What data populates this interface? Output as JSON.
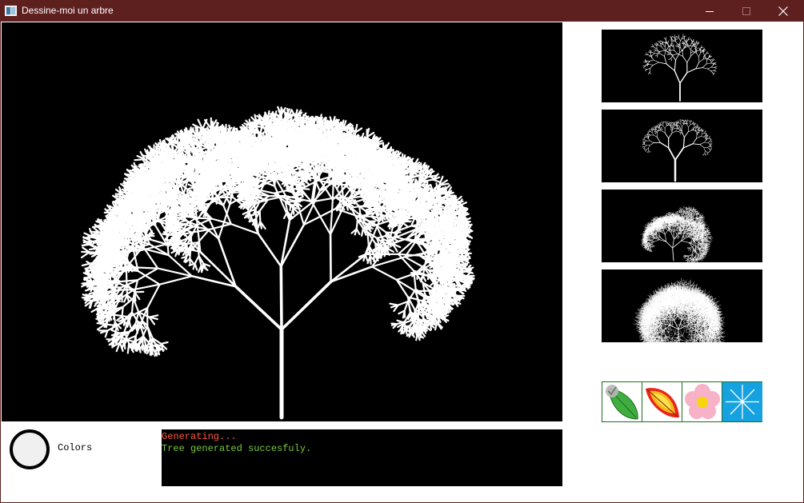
{
  "window": {
    "title": "Dessine-moi un arbre",
    "titlebar_color": "#5e1f1f",
    "controls": [
      "minimize-icon",
      "maximize-icon",
      "close-icon"
    ]
  },
  "main_canvas": {
    "background": "#000000",
    "tree_color": "#ffffff"
  },
  "thumbnails": [
    {
      "name": "tree-preset-1",
      "style": "asymmetric-branching"
    },
    {
      "name": "tree-preset-2",
      "style": "umbrella"
    },
    {
      "name": "tree-preset-3",
      "style": "thin-leaning"
    },
    {
      "name": "tree-preset-4",
      "style": "dense-canopy"
    }
  ],
  "colors": {
    "label": "Colors",
    "selected_color": "#f0f0f0"
  },
  "console": {
    "lines": [
      {
        "text": "Generating...",
        "color": "#ff5a3c"
      },
      {
        "text": "Tree generated succesfuly.",
        "color": "#7ac943"
      }
    ]
  },
  "palette": {
    "items": [
      {
        "name": "leaf-green-icon",
        "selected": true
      },
      {
        "name": "leaf-autumn-icon",
        "selected": false
      },
      {
        "name": "flower-pink-icon",
        "selected": false
      },
      {
        "name": "snowflake-blue-icon",
        "selected": false
      }
    ]
  }
}
